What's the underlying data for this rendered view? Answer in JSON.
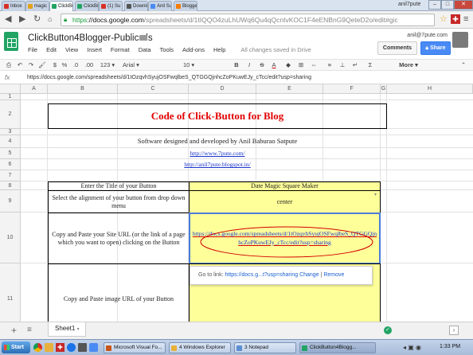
{
  "browser": {
    "tabs": [
      {
        "label": "Inbox",
        "favicon_color": "#d93025"
      },
      {
        "label": "magic",
        "favicon_color": "#e3a21a"
      },
      {
        "label": "ClickBu",
        "favicon_color": "#21a464"
      },
      {
        "label": "ClickBu",
        "favicon_color": "#21a464"
      },
      {
        "label": "(1) Su",
        "favicon_color": "#d93025"
      },
      {
        "label": "Downlo",
        "favicon_color": "#555555"
      },
      {
        "label": "Anil Su",
        "favicon_color": "#4a8af4"
      },
      {
        "label": "Blogge",
        "favicon_color": "#f57d00"
      }
    ],
    "user": "anil7pute",
    "url_scheme": "https",
    "url_rest_host": "://docs.google.com",
    "url_path": "/spreadsheets/d/1tIQQO4zuLhUWq6Qu4qQcntvKOC1F4eENBnG9QeteD2o/edit#gic"
  },
  "app": {
    "title": "ClickButton4Blogger-Public.xls",
    "menus": [
      "File",
      "Edit",
      "View",
      "Insert",
      "Format",
      "Data",
      "Tools",
      "Add-ons",
      "Help"
    ],
    "save_status": "All changes saved in Drive",
    "user_email": "anil@7pute.com",
    "comments_label": "Comments",
    "share_label": "Share"
  },
  "toolbar": {
    "percent_label": "%",
    "decimal_down": ".0",
    "decimal_up": ".00",
    "format_label": "123",
    "font": "Arial",
    "size": "10",
    "bold": "B",
    "italic": "I",
    "strike": "S",
    "text_color": "A",
    "more_label": "More"
  },
  "formula_bar": {
    "label": "fx",
    "content": "https://docs.google.com/spreadsheets/d/1tOzqvhSyujOSFwqlbeS_QTGGQjnhcZoPKuwEJy_cTcc/edit?usp=sharing"
  },
  "grid": {
    "columns": [
      "A",
      "B",
      "C",
      "D",
      "E",
      "F",
      "G",
      "H"
    ],
    "rows": [
      "1",
      "2",
      "3",
      "4",
      "5",
      "6",
      "7",
      "8",
      "9",
      "10",
      "11"
    ],
    "title": "Code of Click-Button for Blog",
    "credit": "Software designed and developed by Anil Baburao Satpute",
    "link1": "http://www.7pute.com/",
    "link2": "http://anil7pute.blogspot.in/",
    "r8_label": "Enter the Title of your Button",
    "r8_value": "Date Magic Square Maker",
    "r9_label": "Select the alignment of your button from drop down menu",
    "r9_value": "center",
    "r10_label": "Copy and Paste your Site URL (or the link of a page which you want to open) clicking on the Button",
    "r10_value": "https://docs.google.com/spreadsheets/d/1tOzqvhSyujOSFwqlbeS_QTGGQjnhcZoPKuwEJy_cTcc/edit?usp=sharing",
    "r11_label": "Copy and Paste image URL of your Button"
  },
  "link_popup": {
    "prefix": "Go to link:",
    "link": "https://docs.g...t?usp=sharing",
    "change": "Change",
    "sep": "|",
    "remove": "Remove"
  },
  "sheets": {
    "add": "+",
    "list": "≡",
    "active": "Sheet1"
  },
  "taskbar": {
    "start": "Start",
    "items": [
      {
        "label": "Microsoft Visual Fo...",
        "color": "#c7561e"
      },
      {
        "label": "4 Windows Explorer",
        "color": "#e8b13c"
      },
      {
        "label": "3 Notepad",
        "color": "#5b8fd1"
      },
      {
        "label": "ClickButton4Blogg...",
        "color": "#21a464"
      }
    ],
    "clock": "1:33 PM"
  }
}
